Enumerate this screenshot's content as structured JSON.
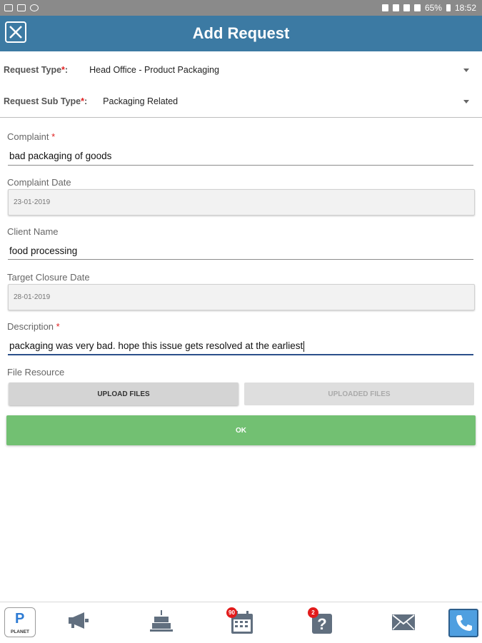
{
  "status_bar": {
    "battery": "65%",
    "time": "18:52"
  },
  "header": {
    "title": "Add Request"
  },
  "request_type": {
    "label": "Request Type",
    "required": "*",
    "colon": ":",
    "value": "Head Office - Product Packaging"
  },
  "request_sub_type": {
    "label": "Request Sub Type",
    "required": "*",
    "colon": ":",
    "value": "Packaging Related"
  },
  "form": {
    "complaint": {
      "label": "Complaint",
      "required": "*",
      "value": "bad packaging of goods"
    },
    "complaint_date": {
      "label": "Complaint Date",
      "value": "23-01-2019"
    },
    "client_name": {
      "label": "Client Name",
      "value": "food processing"
    },
    "target_closure_date": {
      "label": "Target Closure Date",
      "value": "28-01-2019"
    },
    "description": {
      "label": "Description",
      "required": "*",
      "value": "packaging was very bad. hope this issue gets resolved at the earliest"
    },
    "file_resource": {
      "label": "File Resource"
    }
  },
  "buttons": {
    "upload": "UPLOAD FILES",
    "uploaded": "UPLOADED FILES",
    "ok": "OK"
  },
  "bottom_nav": {
    "planet_label": "PLANET",
    "calendar_badge": "90",
    "help_badge": "2"
  },
  "colors": {
    "header": "#3c7aa3",
    "ok_button": "#72c072",
    "required": "#e02020",
    "badge": "#e21b1b"
  }
}
